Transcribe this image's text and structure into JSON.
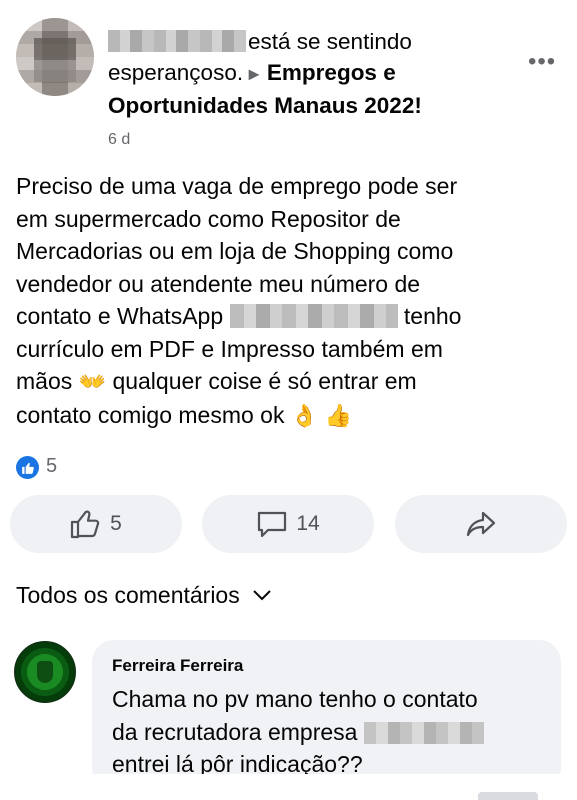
{
  "header": {
    "status_text": "está se sentindo",
    "feeling": "esperançoso.",
    "group_name_line1": "Empregos e",
    "group_name_line2": "Oportunidades Manaus 2022!",
    "time": "6 d",
    "more_glyph": "•••"
  },
  "post": {
    "line1": "Preciso de uma vaga de emprego pode ser",
    "line2": "em supermercado como Repositor de",
    "line3": "Mercadorias ou em loja de Shopping como",
    "line4": "vendedor ou atendente meu número de",
    "line5_start": "contato e WhatsApp",
    "line5_end": "tenho",
    "line6": "currículo em PDF e Impresso também em",
    "line7_start": "mãos",
    "line7_emoji": "👐",
    "line7_end": "qualquer coise é só entrar em",
    "line8": "contato comigo mesmo ok",
    "line8_emoji1": "👌",
    "line8_emoji2": "👍"
  },
  "reactions": {
    "icon": "like-icon",
    "count": "5"
  },
  "actions": {
    "like_count": "5",
    "comment_count": "14",
    "share_icon": "share-icon"
  },
  "comments_filter": {
    "label": "Todos os comentários",
    "chevron": "⌵"
  },
  "comment": {
    "author": "Ferreira Ferreira",
    "line1": "Chama no pv mano tenho o contato",
    "line2_start": "da recrutadora empresa",
    "line3": "entrei lá pôr indicação??"
  },
  "colors": {
    "accent": "#1b74e4",
    "secondary_text": "#65676b",
    "pill_bg": "#eff1f4",
    "bubble_bg": "#f0f2f5"
  }
}
